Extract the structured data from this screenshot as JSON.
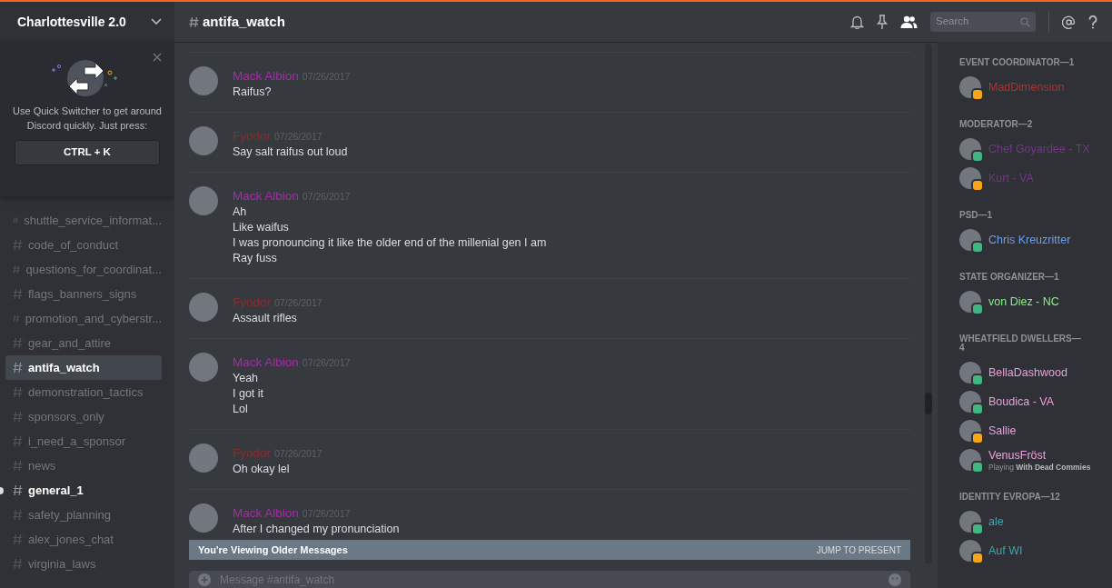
{
  "server": {
    "name": "Charlottesville 2.0"
  },
  "quick_switcher": {
    "text": "Use Quick Switcher to get around Discord quickly. Just press:",
    "shortcut": "CTRL + K"
  },
  "channels": [
    {
      "name": "shuttle_service_informat...",
      "selected": false,
      "unread": false
    },
    {
      "name": "code_of_conduct",
      "selected": false,
      "unread": false
    },
    {
      "name": "questions_for_coordinat...",
      "selected": false,
      "unread": false
    },
    {
      "name": "flags_banners_signs",
      "selected": false,
      "unread": false
    },
    {
      "name": "promotion_and_cyberstr...",
      "selected": false,
      "unread": false
    },
    {
      "name": "gear_and_attire",
      "selected": false,
      "unread": false
    },
    {
      "name": "antifa_watch",
      "selected": true,
      "unread": false
    },
    {
      "name": "demonstration_tactics",
      "selected": false,
      "unread": false
    },
    {
      "name": "sponsors_only",
      "selected": false,
      "unread": false
    },
    {
      "name": "i_need_a_sponsor",
      "selected": false,
      "unread": false
    },
    {
      "name": "news",
      "selected": false,
      "unread": false
    },
    {
      "name": "general_1",
      "selected": false,
      "unread": true
    },
    {
      "name": "safety_planning",
      "selected": false,
      "unread": false
    },
    {
      "name": "alex_jones_chat",
      "selected": false,
      "unread": false
    },
    {
      "name": "virginia_laws",
      "selected": false,
      "unread": false
    }
  ],
  "channel_header": {
    "name": "antifa_watch",
    "search_placeholder": "Search"
  },
  "messages": [
    {
      "author": "Mack Albion",
      "color": "#a82aaa",
      "timestamp": "07/26/2017",
      "lines": [
        "Raifus?"
      ]
    },
    {
      "author": "Fyodor",
      "color": "#8a2b2b",
      "timestamp": "07/26/2017",
      "lines": [
        "Say salt raifus out loud"
      ]
    },
    {
      "author": "Mack Albion",
      "color": "#a82aaa",
      "timestamp": "07/26/2017",
      "lines": [
        "Ah",
        "Like waifus",
        "I was pronouncing it like the older end of the millenial gen I am",
        "Ray fuss"
      ]
    },
    {
      "author": "Fyodor",
      "color": "#8a2b2b",
      "timestamp": "07/26/2017",
      "lines": [
        "Assault rifles"
      ]
    },
    {
      "author": "Mack Albion",
      "color": "#a82aaa",
      "timestamp": "07/26/2017",
      "lines": [
        "Yeah",
        "I got it",
        "Lol"
      ]
    },
    {
      "author": "Fyodor",
      "color": "#8a2b2b",
      "timestamp": "07/26/2017",
      "lines": [
        "Oh okay lel"
      ]
    },
    {
      "author": "Mack Albion",
      "color": "#a82aaa",
      "timestamp": "07/26/2017",
      "lines": [
        "After I changed my pronunciation"
      ]
    }
  ],
  "older_banner": {
    "text": "You're Viewing Older Messages",
    "action": "JUMP TO PRESENT"
  },
  "composer": {
    "placeholder": "Message #antifa_watch"
  },
  "member_groups": [
    {
      "title": "EVENT COORDINATOR—1",
      "members": [
        {
          "name": "MadDimension",
          "color": "#a8342c",
          "idle": true
        }
      ]
    },
    {
      "title": "MODERATOR—2",
      "members": [
        {
          "name": "Chef Goyardee - TX",
          "color": "#71368a",
          "idle": false
        },
        {
          "name": "Kurt - VA",
          "color": "#71368a",
          "idle": true
        }
      ]
    },
    {
      "title": "PSD—1",
      "members": [
        {
          "name": "Chris Kreuzritter",
          "color": "#6a9ff0",
          "idle": false
        }
      ]
    },
    {
      "title": "STATE ORGANIZER—1",
      "members": [
        {
          "name": "von Diez - NC",
          "color": "#86f08a",
          "idle": false
        }
      ]
    },
    {
      "title": "WHEATFIELD DWELLERS—4",
      "members": [
        {
          "name": "BellaDashwood",
          "color": "#eba0da",
          "idle": false
        },
        {
          "name": "Boudica - VA",
          "color": "#eba0da",
          "idle": false
        },
        {
          "name": "Sallie",
          "color": "#eba0da",
          "idle": true
        },
        {
          "name": "VenusFröst",
          "color": "#eba0da",
          "idle": false,
          "activity": "Playing **With Dead Commies**"
        }
      ]
    },
    {
      "title": "IDENTITY EVROPA—12",
      "members": [
        {
          "name": "ale",
          "color": "#3fa6b2",
          "idle": false
        },
        {
          "name": "Auf WI",
          "color": "#3fa6b2",
          "idle": true
        }
      ]
    }
  ]
}
